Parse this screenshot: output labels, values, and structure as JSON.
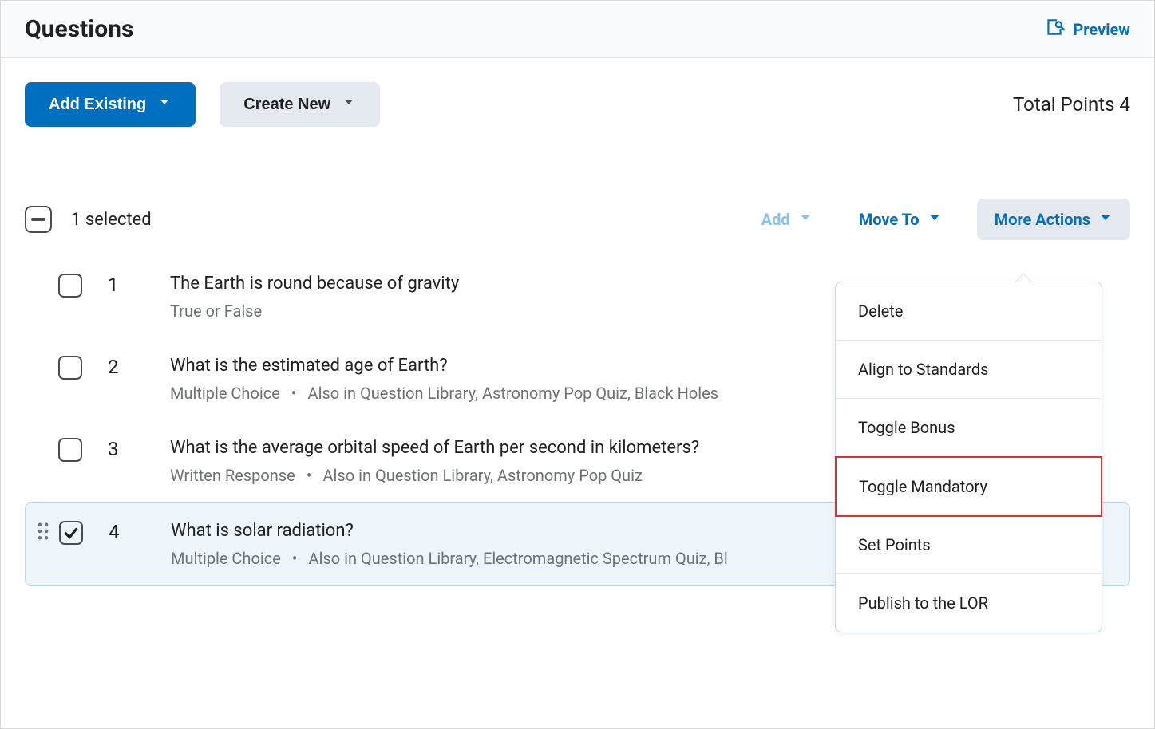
{
  "header": {
    "title": "Questions",
    "preview_label": "Preview"
  },
  "toolbar": {
    "add_existing_label": "Add Existing",
    "create_new_label": "Create New",
    "total_points_label": "Total Points 4"
  },
  "selection_bar": {
    "selected_count_text": "1 selected",
    "add_label": "Add",
    "move_to_label": "Move To",
    "more_actions_label": "More Actions"
  },
  "questions": [
    {
      "number": "1",
      "title": "The Earth is round because of gravity",
      "type": "True or False",
      "also_in": "",
      "checked": false
    },
    {
      "number": "2",
      "title": "What is the estimated age of Earth?",
      "type": "Multiple Choice",
      "also_in": "Also in Question Library, Astronomy Pop Quiz, Black Holes",
      "checked": false
    },
    {
      "number": "3",
      "title": "What is the average orbital speed of Earth per second in kilometers?",
      "type": "Written Response",
      "also_in": "Also in Question Library, Astronomy Pop Quiz",
      "checked": false
    },
    {
      "number": "4",
      "title": "What is solar radiation?",
      "type": "Multiple Choice",
      "also_in": "Also in Question Library, Electromagnetic Spectrum Quiz, Bl",
      "checked": true
    }
  ],
  "dropdown": {
    "items": [
      "Delete",
      "Align to Standards",
      "Toggle Bonus",
      "Toggle Mandatory",
      "Set Points",
      "Publish to the LOR"
    ],
    "highlighted_index": 3
  }
}
